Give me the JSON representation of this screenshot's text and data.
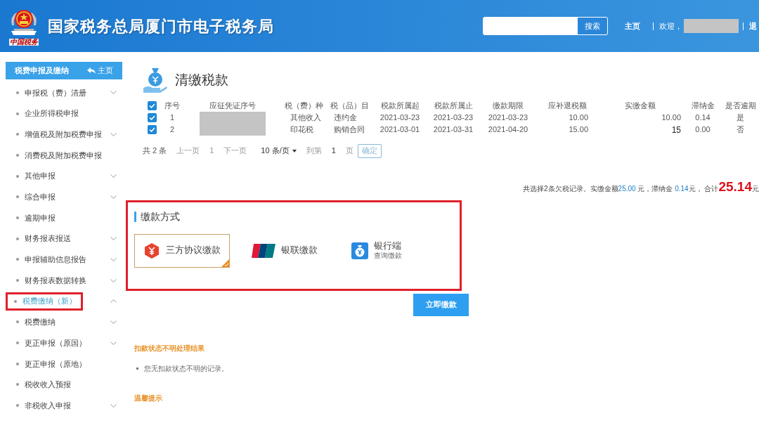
{
  "header": {
    "logo_caption": "中国税务",
    "title": "国家税务总局厦门市电子税务局",
    "search": {
      "button": "搜索"
    },
    "links": [
      "主页",
      "欢迎，"
    ],
    "logout": "退"
  },
  "sidebar": {
    "title": "税费申报及缴纳",
    "home": "主页",
    "items": [
      {
        "label": "申报税（费）清册",
        "expanded": false,
        "selected": false
      },
      {
        "label": "企业所得税申报",
        "selected": false
      },
      {
        "label": "增值税及附加税费申报",
        "expanded": false,
        "selected": false
      },
      {
        "label": "消费税及附加税费申报",
        "selected": false
      },
      {
        "label": "其他申报",
        "expanded": false,
        "selected": false
      },
      {
        "label": "综合申报",
        "expanded": false,
        "selected": false
      },
      {
        "label": "逾期申报",
        "selected": false
      },
      {
        "label": "财务报表报送",
        "expanded": false,
        "selected": false
      },
      {
        "label": "申报辅助信息报告",
        "expanded": false,
        "selected": false
      },
      {
        "label": "财务报表数据转换",
        "expanded": false,
        "selected": false
      },
      {
        "label": "税费缴纳（新）",
        "expanded": true,
        "selected": true
      },
      {
        "label": "税费缴纳",
        "expanded": false,
        "selected": false
      },
      {
        "label": "更正申报（原国）",
        "expanded": false,
        "selected": false
      },
      {
        "label": "更正申报（原地）",
        "selected": false
      },
      {
        "label": "税收收入预报",
        "selected": false
      },
      {
        "label": "非税收入申报",
        "expanded": false,
        "selected": false
      }
    ]
  },
  "page_title": "清缴税款",
  "table": {
    "all_checked": true,
    "columns": [
      "序号",
      "应征凭证序号",
      "税（费）种",
      "税（品）目",
      "税款所属起",
      "税款所属止",
      "缴款期限",
      "应补退税额",
      "实缴金额",
      "滞纳金",
      "是否逾期"
    ],
    "rows": [
      {
        "checked": true,
        "cells": [
          "1",
          "",
          "其他收入",
          "违约金",
          "2021-03-23",
          "2021-03-23",
          "2021-03-23",
          "10.00",
          "10.00",
          "0.14",
          "是"
        ]
      },
      {
        "checked": true,
        "cells": [
          "2",
          "",
          "印花税",
          "购销合同",
          "2021-03-01",
          "2021-03-31",
          "2021-04-20",
          "15.00",
          "15",
          "0.00",
          "否"
        ]
      }
    ]
  },
  "pagination": {
    "total": "共 2 条",
    "prev": "上一页",
    "page": "1",
    "next": "下一页",
    "page_size": "10 条/页",
    "goto": "到第",
    "goto_value": "1",
    "page_unit": "页",
    "confirm": "确定"
  },
  "summary": {
    "text": "共选择2条欠税记录。实缴金额",
    "paid": "25.00",
    "paid_unit": " 元，滞纳金 ",
    "late": "0.14",
    "late_unit": "元，  合计",
    "total": "25.14",
    "total_unit": "元"
  },
  "payment": {
    "title": "缴款方式",
    "methods": [
      {
        "kind": "agreement",
        "label": "三方协议缴款",
        "selected": true
      },
      {
        "kind": "unionpay",
        "label": "银联缴款",
        "selected": false
      },
      {
        "kind": "bank",
        "label": "银行端",
        "sublabel": "查询缴款",
        "selected": false
      }
    ],
    "button": "立即缴款"
  },
  "deduction": {
    "title": "扣款状态不明处理结果",
    "items": [
      "您无扣款状态不明的记录。"
    ]
  },
  "tips": {
    "title": "温馨提示"
  }
}
